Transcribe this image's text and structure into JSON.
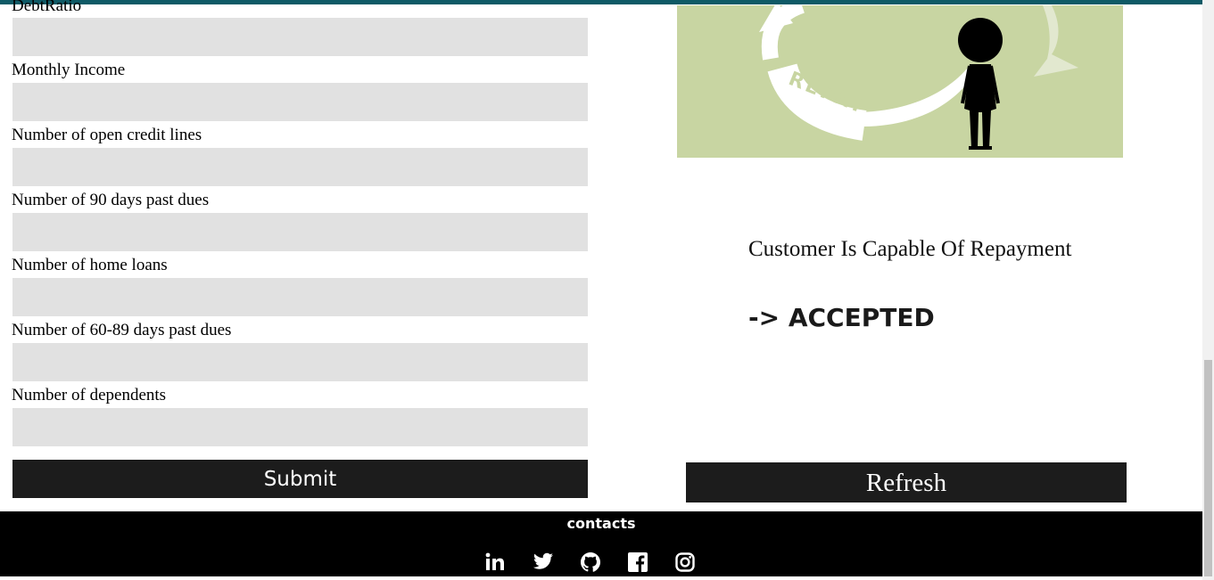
{
  "form": {
    "partial_label": "DebtRatio",
    "fields": [
      {
        "label": "Monthly Income",
        "value": ""
      },
      {
        "label": "Number of open credit lines",
        "value": ""
      },
      {
        "label": "Number of 90 days past dues",
        "value": ""
      },
      {
        "label": "Number of home loans",
        "value": ""
      },
      {
        "label": "Number of 60-89 days past dues",
        "value": ""
      },
      {
        "label": "Number of dependents",
        "value": ""
      }
    ],
    "submit_label": "Submit"
  },
  "illustration": {
    "text": "REPAY",
    "colors": {
      "background": "#c8d5a2",
      "figure": "#000000",
      "arrow": "#ffffff"
    }
  },
  "result": {
    "message": "Customer Is Capable Of Repayment",
    "status": "-> ACCEPTED"
  },
  "refresh_label": "Refresh",
  "footer": {
    "title": "contacts",
    "icons": [
      "linkedin-icon",
      "twitter-icon",
      "github-icon",
      "facebook-icon",
      "instagram-icon"
    ]
  },
  "colors": {
    "topbar": "#0f5a66",
    "input_bg": "#e1e1e1",
    "button_bg": "#1c1c1c",
    "footer_bg": "#000000"
  }
}
